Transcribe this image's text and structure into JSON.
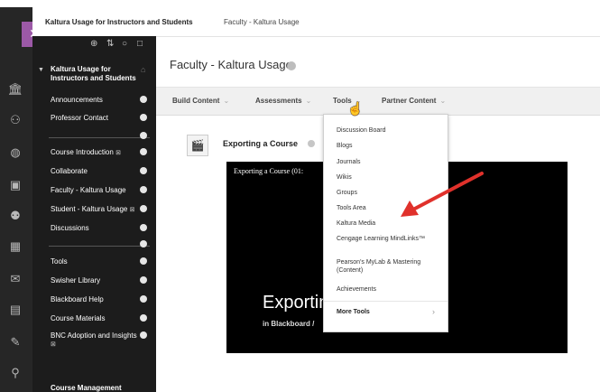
{
  "breadcrumb": {
    "course": "Kaltura Usage for Instructors and Students",
    "page": "Faculty - Kaltura Usage"
  },
  "rail": {
    "close_icon": "close-icon",
    "icons": [
      "institution-icon",
      "person-icon",
      "globe-icon",
      "courses-icon",
      "organizations-icon",
      "calendar-icon",
      "messages-icon",
      "grades-icon",
      "edit-icon",
      "tools-icon"
    ]
  },
  "course_menu": {
    "title_line1": "Kaltura Usage for",
    "title_line2": "Instructors and Students",
    "group1": [
      "Announcements",
      "Professor Contact"
    ],
    "group2": [
      "Course Introduction",
      "Collaborate",
      "Faculty - Kaltura Usage",
      "Student - Kaltura Usage",
      "Discussions"
    ],
    "group3": [
      "Tools",
      "Swisher Library",
      "Blackboard Help",
      "Course Materials",
      "BNC Adoption and Insights"
    ],
    "footer": "Course Management"
  },
  "page": {
    "title": "Faculty - Kaltura Usage"
  },
  "toolbar": {
    "build": "Build Content",
    "assessments": "Assessments",
    "tools": "Tools",
    "partner": "Partner Content"
  },
  "content_item": {
    "title": "Exporting a Course"
  },
  "video": {
    "title": "Exporting a Course (01:",
    "big": "Exportin",
    "sub": "in Blackboard /"
  },
  "tools_menu": {
    "items": [
      "Discussion Board",
      "Blogs",
      "Journals",
      "Wikis",
      "Groups",
      "Tools Area",
      "Kaltura Media",
      "Cengage Learning MindLinks™",
      "Pearson's MyLab & Mastering (Content)",
      "Achievements"
    ],
    "more": "More Tools"
  },
  "colors": {
    "accent": "#9c59a7",
    "annotation_arrow": "#e0312b"
  }
}
